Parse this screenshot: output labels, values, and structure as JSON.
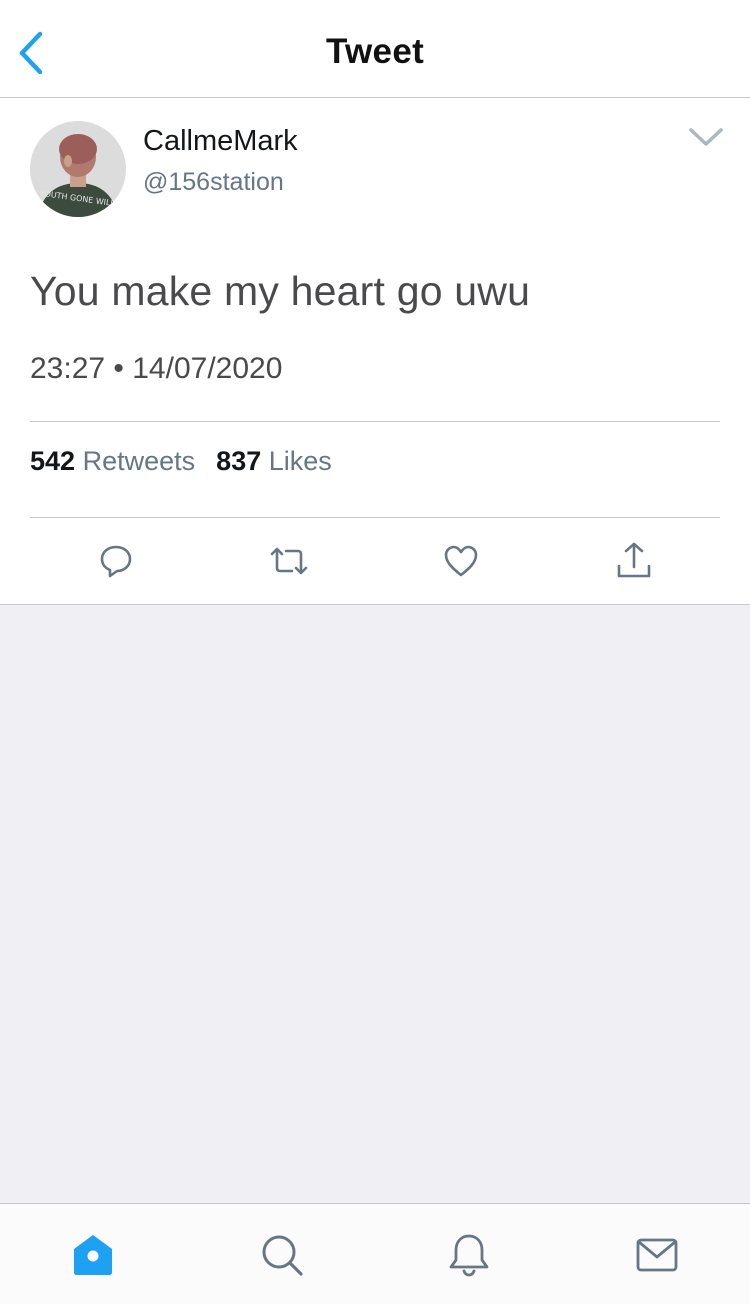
{
  "header": {
    "title": "Tweet",
    "back_icon": "chevron-left-icon"
  },
  "tweet": {
    "author": {
      "display_name": "CallmeMark",
      "handle": "@156station",
      "avatar_caption": "YOUTH GONE WILD"
    },
    "text": "You make my heart go uwu",
    "timestamp": "23:27 • 14/07/2020",
    "retweets": {
      "count": "542",
      "label": "Retweets"
    },
    "likes": {
      "count": "837",
      "label": "Likes"
    },
    "actions": [
      "reply-icon",
      "retweet-icon",
      "like-icon",
      "share-icon"
    ]
  },
  "tabbar": {
    "tabs": [
      "home-icon",
      "search-icon",
      "notifications-icon",
      "messages-icon"
    ],
    "active": "home-icon"
  },
  "colors": {
    "accent": "#1da1f2",
    "text_primary": "#14171a",
    "text_secondary": "#657786",
    "background_gray": "#efeff4",
    "divider": "#c8c7cc"
  }
}
